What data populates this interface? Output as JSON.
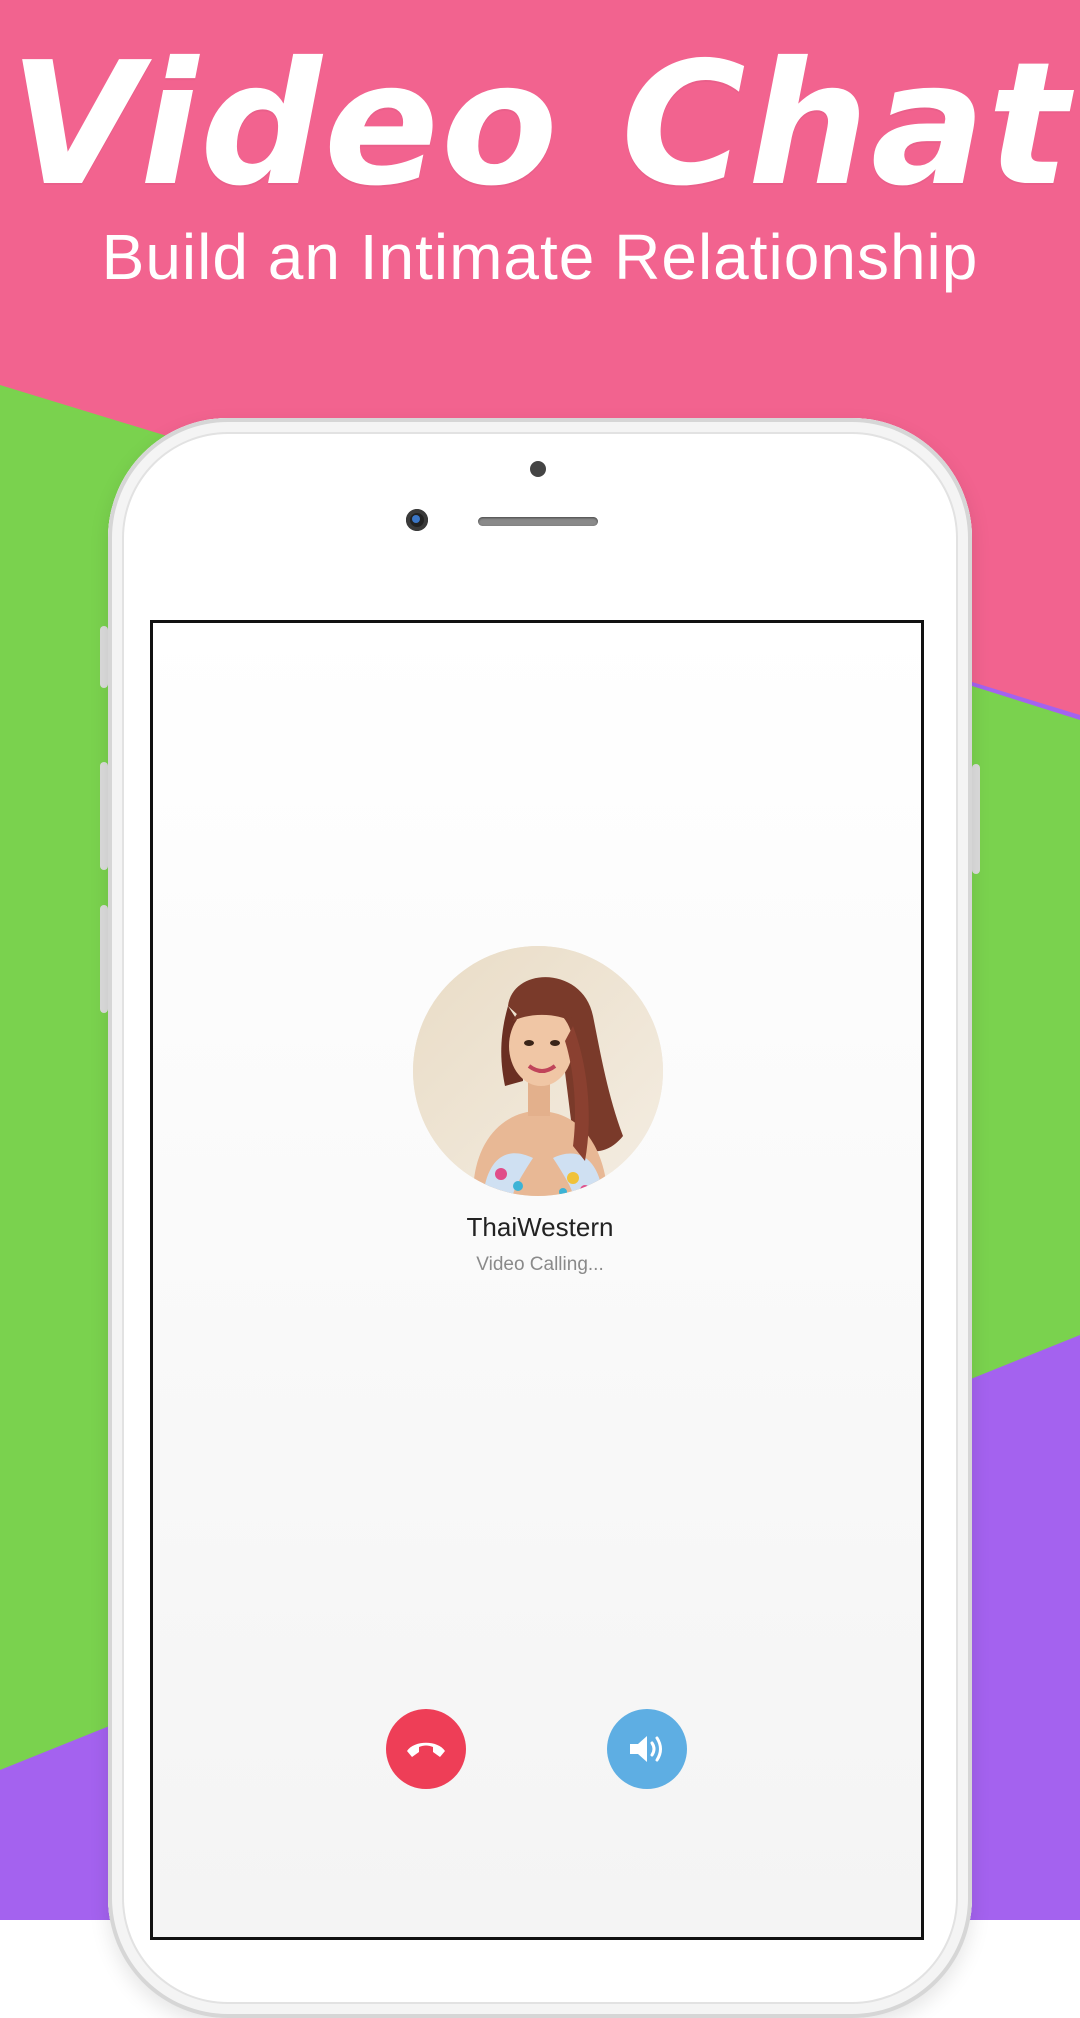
{
  "headline": {
    "title": "Video Chat",
    "subtitle": "Build an Intimate Relationship"
  },
  "colors": {
    "pink": "#f2638f",
    "green": "#7ad24e",
    "purple": "#a462ef",
    "hangup": "#ee3e57",
    "speaker": "#5eaee3"
  },
  "call": {
    "caller_name": "ThaiWestern",
    "status": "Video Calling...",
    "avatar_icon": "caller-photo",
    "hangup_icon": "phone-hangup-icon",
    "speaker_icon": "speaker-volume-icon"
  }
}
